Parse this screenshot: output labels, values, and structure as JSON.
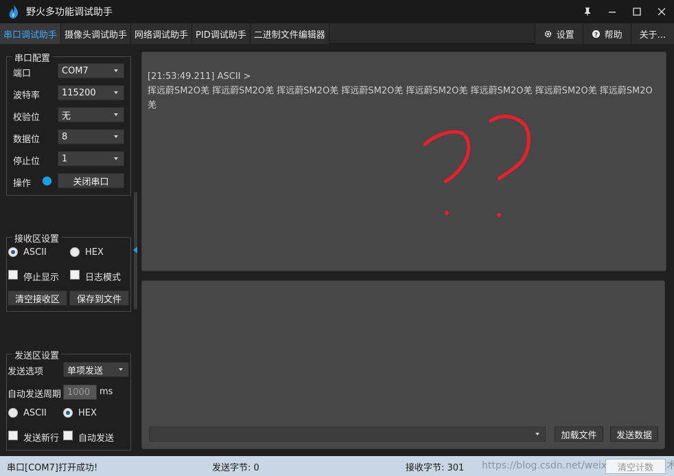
{
  "window": {
    "title": "野火多功能调试助手",
    "accent": "#3aa9ff"
  },
  "tabs": [
    "串口调试助手",
    "摄像头调试助手",
    "网络调试助手",
    "PID调试助手",
    "二进制文件编辑器"
  ],
  "right_menu": {
    "settings": "设置",
    "help": "帮助",
    "about": "关于..."
  },
  "serial_config": {
    "title": "串口配置",
    "port_label": "端口",
    "port_value": "COM7",
    "baud_label": "波特率",
    "baud_value": "115200",
    "parity_label": "校验位",
    "parity_value": "无",
    "databits_label": "数据位",
    "databits_value": "8",
    "stopbits_label": "停止位",
    "stopbits_value": "1",
    "operate_label": "操作",
    "close_port_button": "关闭串口"
  },
  "recv_settings": {
    "title": "接收区设置",
    "ascii_label": "ASCII",
    "hex_label": "HEX",
    "stop_display_label": "停止显示",
    "log_mode_label": "日志模式",
    "clear_button": "清空接收区",
    "save_button": "保存到文件"
  },
  "send_settings": {
    "title": "发送区设置",
    "option_label": "发送选项",
    "option_value": "单项发送",
    "auto_period_label": "自动发送周期",
    "auto_period_value": "1000",
    "ms_label": "ms",
    "ascii_label": "ASCII",
    "hex_label": "HEX",
    "newline_label": "发送新行",
    "auto_send_label": "自动发送"
  },
  "receive_area": {
    "header": "[21:53:49.211] ASCII >",
    "content": "挥远蔚SM2O羌 挥远蔚SM2O羌 挥远蔚SM2O羌 挥远蔚SM2O羌 挥远蔚SM2O羌 挥远蔚SM2O羌 挥远蔚SM2O羌 挥远蔚SM2O羌"
  },
  "send_area": {
    "load_file_button": "加载文件",
    "send_button": "发送数据"
  },
  "status": {
    "message": "串口[COM7]打开成功!",
    "sent_bytes": "发送字节: 0",
    "recv_bytes": "接收字节: 301",
    "clear_count_button": "清空计数",
    "watermark": "https://blog.csdn.net/weixin 稀土掘金技术社区"
  }
}
